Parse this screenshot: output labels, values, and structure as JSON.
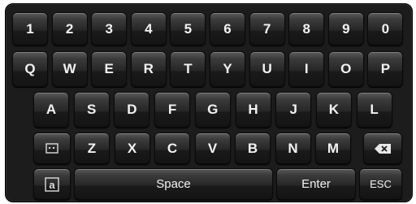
{
  "keyboard": {
    "row1": [
      "1",
      "2",
      "3",
      "4",
      "5",
      "6",
      "7",
      "8",
      "9",
      "0"
    ],
    "row2": [
      "Q",
      "W",
      "E",
      "R",
      "T",
      "Y",
      "U",
      "I",
      "O",
      "P"
    ],
    "row3": [
      "A",
      "S",
      "D",
      "F",
      "G",
      "H",
      "J",
      "K",
      "L"
    ],
    "row4": [
      "Z",
      "X",
      "C",
      "V",
      "B",
      "N",
      "M"
    ],
    "space_label": "Space",
    "enter_label": "Enter",
    "esc_label": "ESC",
    "icons": {
      "mode": "keyboard-mode-icon",
      "backspace": "backspace-icon",
      "case": "case-toggle-icon"
    },
    "case_glyph": "a"
  }
}
